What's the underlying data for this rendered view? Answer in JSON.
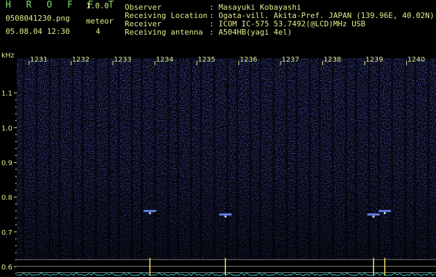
{
  "header": {
    "app_name": "H R O F F T",
    "version": "1.0.0",
    "file_name": "0508041230.png",
    "datetime": "05.08.04 12:30",
    "meteor_label": "meteor",
    "meteor_count": "4",
    "info": [
      {
        "label": "Observer",
        "value": ": Masayuki Kobayashi"
      },
      {
        "label": "Receiving Location",
        "value": ": Ogata-vill. Akita-Pref. JAPAN (139.96E, 40.02N)"
      },
      {
        "label": "Receiver",
        "value": ": ICOM IC-575 53.7492(@LCD)MHz USB"
      },
      {
        "label": "Receiving antenna",
        "value": ": A504HB(yagi 4el)"
      }
    ]
  },
  "colors": {
    "text": "#e6ec8c",
    "appname": "#7fe26c",
    "spectrum": "#1e2aa8",
    "peak": "#ffe35a",
    "trace": "#2ec8c8",
    "background": "#000000"
  },
  "chart_data": {
    "type": "heatmap",
    "title": "",
    "xlabel": "",
    "ylabel": "kHz",
    "x_ticks": [
      "1231",
      "1232",
      "1233",
      "1234",
      "1235",
      "1236",
      "1237",
      "1238",
      "1239",
      "1240"
    ],
    "y_ticks": [
      "1.1",
      "1.0",
      "0.9",
      "0.8",
      "0.7",
      "0.6"
    ],
    "ylim": [
      0.57,
      1.2
    ],
    "meteor_echoes": [
      {
        "minute": 1233.65,
        "freq_khz": 0.76
      },
      {
        "minute": 1235.45,
        "freq_khz": 0.75
      },
      {
        "minute": 1238.98,
        "freq_khz": 0.75
      },
      {
        "minute": 1239.25,
        "freq_khz": 0.76
      }
    ]
  }
}
